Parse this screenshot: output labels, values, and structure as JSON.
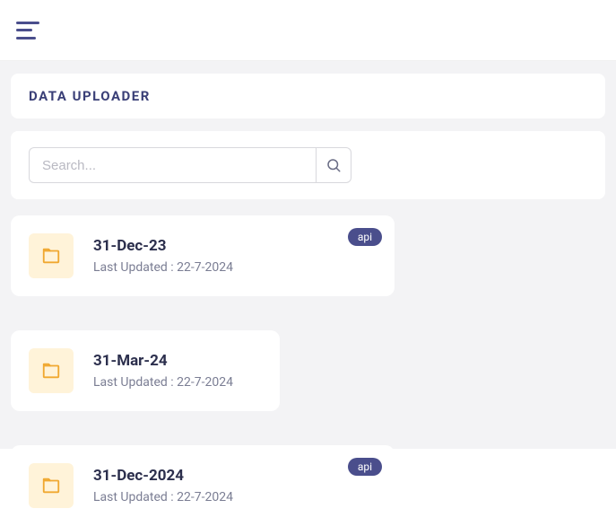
{
  "header": {
    "title": "DATA UPLOADER"
  },
  "search": {
    "placeholder": "Search..."
  },
  "badge_label": "api",
  "last_updated_prefix": "Last Updated : ",
  "cards": [
    {
      "title": "31-Dec-23",
      "updated": "22-7-2024",
      "badge": true,
      "narrow": false
    },
    {
      "title": "31-Mar-24",
      "updated": "22-7-2024",
      "badge": false,
      "narrow": true
    },
    {
      "title": "31-Dec-2024",
      "updated": "22-7-2024",
      "badge": true,
      "narrow": false
    }
  ]
}
